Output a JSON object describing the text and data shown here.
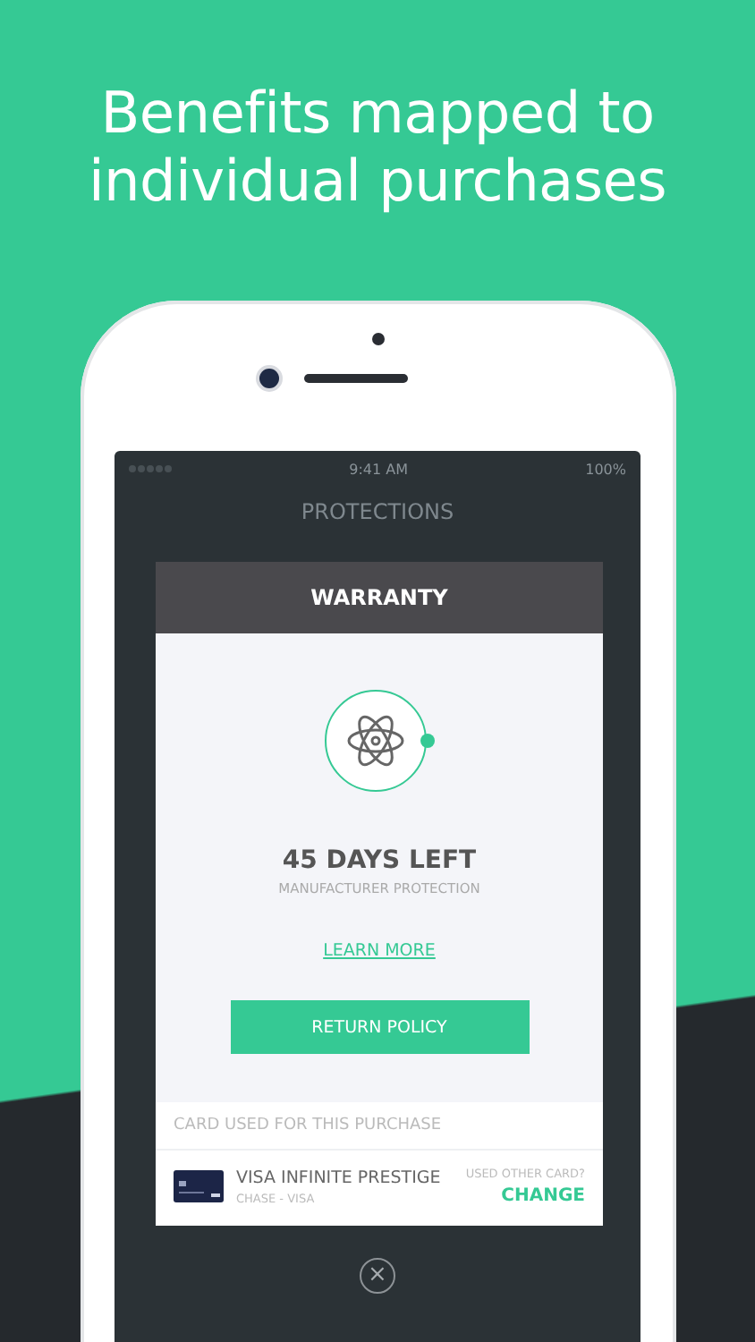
{
  "headline_lines": [
    "Benefits mapped to",
    "individual purchases"
  ],
  "status_bar": {
    "time": "9:41 AM",
    "battery": "100%"
  },
  "screen_title": "PROTECTIONS",
  "modal": {
    "title": "WARRANTY",
    "days_left": "45 DAYS LEFT",
    "subtitle": "MANUFACTURER PROTECTION",
    "link": "LEARN MORE",
    "button": "RETURN POLICY",
    "card_section": {
      "heading": "CARD USED FOR THIS PURCHASE",
      "card_name": "VISA INFINITE PRESTIGE",
      "card_issuer": "CHASE - VISA",
      "prompt": "USED OTHER CARD?",
      "action": "CHANGE"
    }
  },
  "close_button": "×"
}
